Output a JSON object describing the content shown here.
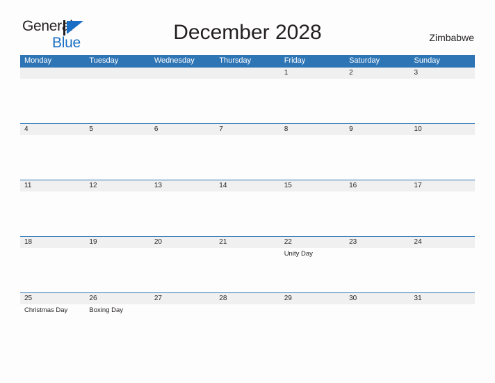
{
  "brand": {
    "word1": "General",
    "word2": "Blue",
    "flag_icon": "triangle-flag-icon",
    "color_dark": "#231F20",
    "color_blue": "#1A6FC4"
  },
  "header": {
    "title": "December 2028",
    "country": "Zimbabwe"
  },
  "theme": {
    "header_blue": "#2E75B6",
    "band_gray": "#F0F0F0",
    "page_bg": "#FDFDFD",
    "text": "#231F20"
  },
  "calendar": {
    "weekdays": [
      "Monday",
      "Tuesday",
      "Wednesday",
      "Thursday",
      "Friday",
      "Saturday",
      "Sunday"
    ],
    "weeks": [
      {
        "days": [
          {
            "date": "",
            "event": ""
          },
          {
            "date": "",
            "event": ""
          },
          {
            "date": "",
            "event": ""
          },
          {
            "date": "",
            "event": ""
          },
          {
            "date": "1",
            "event": ""
          },
          {
            "date": "2",
            "event": ""
          },
          {
            "date": "3",
            "event": ""
          }
        ]
      },
      {
        "days": [
          {
            "date": "4",
            "event": ""
          },
          {
            "date": "5",
            "event": ""
          },
          {
            "date": "6",
            "event": ""
          },
          {
            "date": "7",
            "event": ""
          },
          {
            "date": "8",
            "event": ""
          },
          {
            "date": "9",
            "event": ""
          },
          {
            "date": "10",
            "event": ""
          }
        ]
      },
      {
        "days": [
          {
            "date": "11",
            "event": ""
          },
          {
            "date": "12",
            "event": ""
          },
          {
            "date": "13",
            "event": ""
          },
          {
            "date": "14",
            "event": ""
          },
          {
            "date": "15",
            "event": ""
          },
          {
            "date": "16",
            "event": ""
          },
          {
            "date": "17",
            "event": ""
          }
        ]
      },
      {
        "days": [
          {
            "date": "18",
            "event": ""
          },
          {
            "date": "19",
            "event": ""
          },
          {
            "date": "20",
            "event": ""
          },
          {
            "date": "21",
            "event": ""
          },
          {
            "date": "22",
            "event": "Unity Day"
          },
          {
            "date": "23",
            "event": ""
          },
          {
            "date": "24",
            "event": ""
          }
        ]
      },
      {
        "days": [
          {
            "date": "25",
            "event": "Christmas Day"
          },
          {
            "date": "26",
            "event": "Boxing Day"
          },
          {
            "date": "27",
            "event": ""
          },
          {
            "date": "28",
            "event": ""
          },
          {
            "date": "29",
            "event": ""
          },
          {
            "date": "30",
            "event": ""
          },
          {
            "date": "31",
            "event": ""
          }
        ]
      }
    ]
  }
}
